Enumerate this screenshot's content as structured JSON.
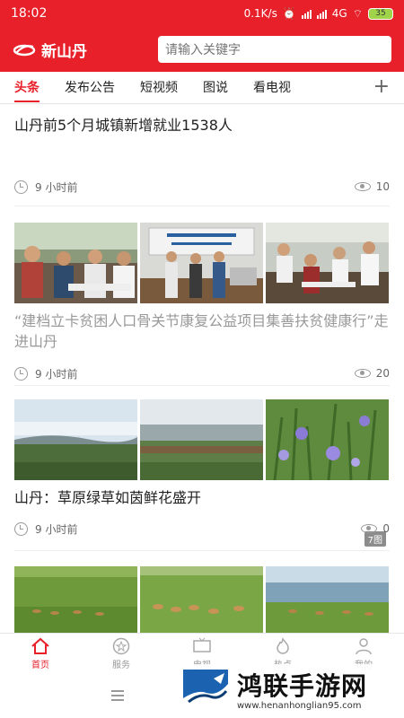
{
  "status_bar": {
    "time": "18:02",
    "speed": "0.1K/s",
    "network": "4G",
    "battery": "35"
  },
  "header": {
    "logo_text": "新山丹",
    "search_placeholder": "请输入关键字"
  },
  "tabs": [
    {
      "label": "头条",
      "active": true
    },
    {
      "label": "发布公告"
    },
    {
      "label": "短视频"
    },
    {
      "label": "图说"
    },
    {
      "label": "看电视"
    }
  ],
  "feed": [
    {
      "title": "山丹前5个月城镇新增就业1538人",
      "time": "9 小时前",
      "views": "10"
    },
    {
      "title": "“建档立卡贫困人口骨关节康复公益项目集善扶贫健康行”走进山丹",
      "time": "9 小时前",
      "views": "20"
    },
    {
      "title": "山丹：草原绿草如茵鲜花盛开",
      "time": "9 小时前",
      "views": "0",
      "image_count": "7图"
    }
  ],
  "bottom_nav": [
    {
      "label": "首页",
      "active": true
    },
    {
      "label": "服务"
    },
    {
      "label": "电视"
    },
    {
      "label": "热点"
    },
    {
      "label": "我的"
    }
  ],
  "watermark": {
    "title": "鸿联手游网",
    "url": "www.henanhonglian95.com"
  },
  "colors": {
    "brand": "#e8202a"
  }
}
